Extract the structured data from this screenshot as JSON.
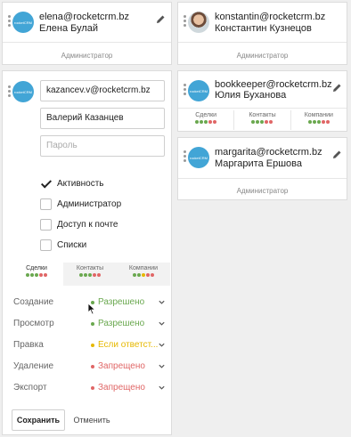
{
  "users": [
    {
      "email": "elena@rocketcrm.bz",
      "name": "Елена Булай",
      "role": "Администратор",
      "avatar": "rocketCRM"
    },
    {
      "email": "konstantin@rocketcrm.bz",
      "name": "Константин Кузнецов",
      "role": "Администратор",
      "avatar": "photo"
    },
    {
      "email": "bookkeeper@rocketcrm.bz",
      "name": "Юлия Буханова",
      "avatar": "rocketCRM",
      "tabs": [
        {
          "label": "Сделки",
          "dots": [
            "g",
            "g",
            "g",
            "r",
            "r"
          ]
        },
        {
          "label": "Контакты",
          "dots": [
            "g",
            "g",
            "g",
            "r",
            "r"
          ]
        },
        {
          "label": "Компании",
          "dots": [
            "g",
            "g",
            "g",
            "r",
            "r"
          ]
        }
      ]
    },
    {
      "email": "margarita@rocketcrm.bz",
      "name": "Маргарита Ершова",
      "role": "Администратор",
      "avatar": "rocketCRM"
    }
  ],
  "editor": {
    "avatar": "rocketCRM",
    "email_value": "kazancev.v@rocketcrm.bz",
    "name_value": "Валерий Казанцев",
    "password_placeholder": "Пароль",
    "checkboxes": [
      {
        "label": "Активность",
        "checked": true
      },
      {
        "label": "Администратор",
        "checked": false
      },
      {
        "label": "Доступ к почте",
        "checked": false
      },
      {
        "label": "Списки",
        "checked": false
      }
    ],
    "tabs": [
      {
        "label": "Сделки",
        "dots": [
          "g",
          "g",
          "g",
          "r",
          "r"
        ],
        "active": true
      },
      {
        "label": "Контакты",
        "dots": [
          "g",
          "g",
          "g",
          "r",
          "r"
        ],
        "active": false
      },
      {
        "label": "Компании",
        "dots": [
          "g",
          "g",
          "y",
          "r",
          "r"
        ],
        "active": false
      }
    ],
    "permissions": [
      {
        "label": "Создание",
        "value": "Разрешено",
        "color": "#6aa84f"
      },
      {
        "label": "Просмотр",
        "value": "Разрешено",
        "color": "#6aa84f"
      },
      {
        "label": "Правка",
        "value": "Если ответст...",
        "color": "#e6b800"
      },
      {
        "label": "Удаление",
        "value": "Запрещено",
        "color": "#e06666"
      },
      {
        "label": "Экспорт",
        "value": "Запрещено",
        "color": "#e06666"
      }
    ],
    "save_label": "Сохранить",
    "cancel_label": "Отменить"
  }
}
